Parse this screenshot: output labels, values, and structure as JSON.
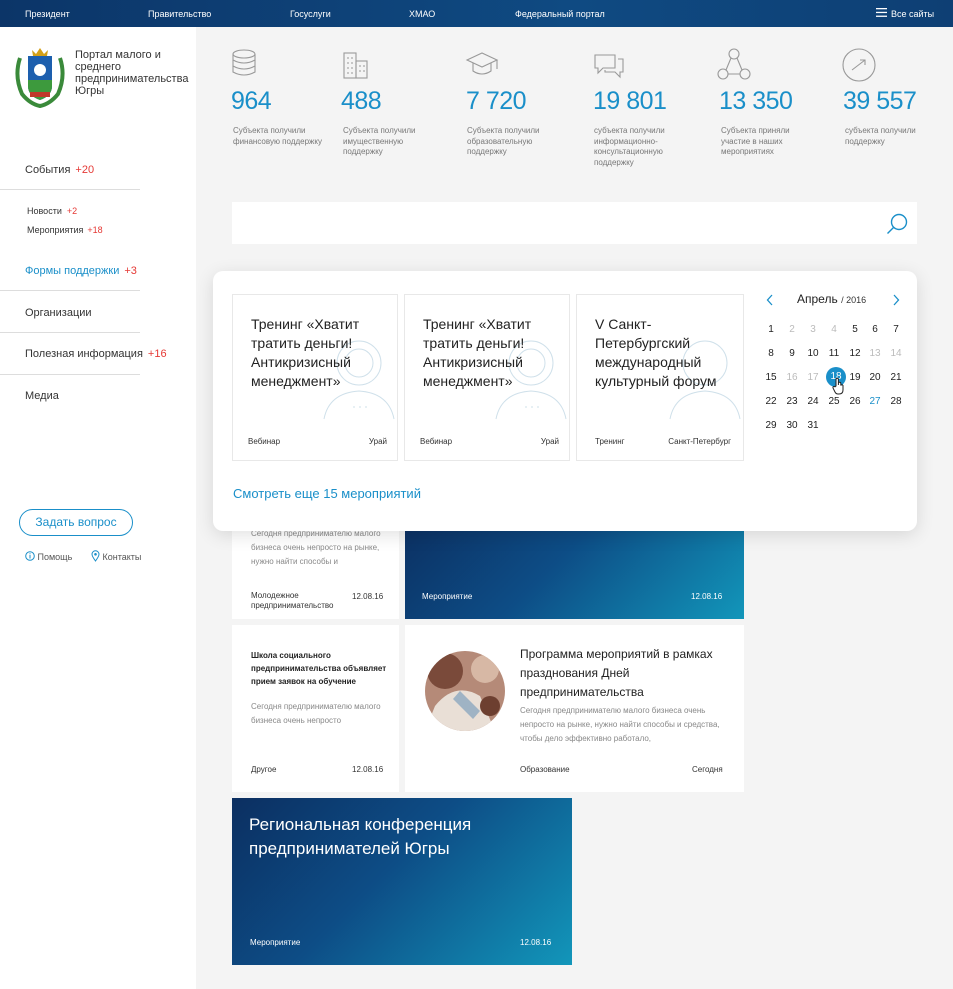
{
  "topbar": {
    "links": [
      "Президент",
      "Правительство",
      "Госуслуги",
      "ХМАО",
      "Федеральный портал"
    ],
    "all_sites": "Все сайты"
  },
  "portal": {
    "title": "Портал малого и среднего предпринимательства Югры"
  },
  "sidebar": {
    "events": {
      "label": "События",
      "count": "+20"
    },
    "news": {
      "label": "Новости",
      "count": "+2"
    },
    "activities": {
      "label": "Мероприятия",
      "count": "+18"
    },
    "support": {
      "label": "Формы поддержки",
      "count": "+3"
    },
    "orgs": {
      "label": "Организации"
    },
    "useful": {
      "label": "Полезная информация",
      "count": "+16"
    },
    "media": {
      "label": "Медиа"
    },
    "ask_button": "Задать вопрос",
    "help": "Помощь",
    "contacts": "Контакты"
  },
  "stats": [
    {
      "icon": "coins-icon",
      "value": "964",
      "desc": "Субъекта получили финансовую поддержку"
    },
    {
      "icon": "building-icon",
      "value": "488",
      "desc": "Субъекта получили имущественную поддержку"
    },
    {
      "icon": "graduation-cap-icon",
      "value": "7 720",
      "desc": "Субъекта получили образовательную поддержку"
    },
    {
      "icon": "chat-bubbles-icon",
      "value": "19 801",
      "desc": "субъекта получили информационно-консультационную поддержку"
    },
    {
      "icon": "network-icon",
      "value": "13 350",
      "desc": "Субъекта приняли участие в наших мероприятиях"
    },
    {
      "icon": "trend-arrow-icon",
      "value": "39 557",
      "desc": "субъекта получили поддержку"
    }
  ],
  "events": [
    {
      "title": "Тренинг «Хватит тратить деньги! Антикризисный менеджмент»",
      "type": "Вебинар",
      "place": "Урай"
    },
    {
      "title": "Тренинг «Хватит тратить деньги! Антикризисный менеджмент»",
      "type": "Вебинар",
      "place": "Урай"
    },
    {
      "title": "V Санкт-Петербургский международный культурный форум",
      "type": "Тренинг",
      "place": "Санкт-Петербург"
    }
  ],
  "calendar": {
    "month": "Апрель",
    "year": "/ 2016",
    "selected": "18",
    "days": [
      [
        "1",
        "2",
        "3",
        "4",
        "5",
        "6",
        "7"
      ],
      [
        "8",
        "9",
        "10",
        "11",
        "12",
        "13",
        "14"
      ],
      [
        "15",
        "16",
        "17",
        "18",
        "19",
        "20",
        "21"
      ],
      [
        "22",
        "23",
        "24",
        "25",
        "26",
        "27",
        "28"
      ],
      [
        "29",
        "30",
        "31"
      ]
    ]
  },
  "more_events": "Смотреть еще 15 мероприятий",
  "feed": {
    "card1": {
      "text": "Сегодня предпринимателю малого бизнеса очень непросто на рынке, нужно найти способы и",
      "category": "Молодежное предпринимательство",
      "date": "12.08.16"
    },
    "card2": {
      "category": "Мероприятие",
      "date": "12.08.16"
    },
    "card3": {
      "title": "Школа социального предпринимательства объявляет прием заявок на обучение",
      "text": "Сегодня предпринимателю малого бизнеса очень непросто",
      "category": "Другое",
      "date": "12.08.16"
    },
    "card4": {
      "title": "Программа мероприятий в рамках празднования Дней предпринимательства",
      "text": "Сегодня предпринимателю малого бизнеса очень непросто на рынке, нужно найти способы и средства, чтобы дело эффективно работало,",
      "category": "Образование",
      "date": "Сегодня"
    },
    "card5": {
      "title": "Региональная конференция предпринимателей Югры",
      "category": "Мероприятие",
      "date": "12.08.16"
    }
  },
  "colors": {
    "accent": "#1a8fc9",
    "counter": "#e53935",
    "topbar": "#0f4a82"
  }
}
